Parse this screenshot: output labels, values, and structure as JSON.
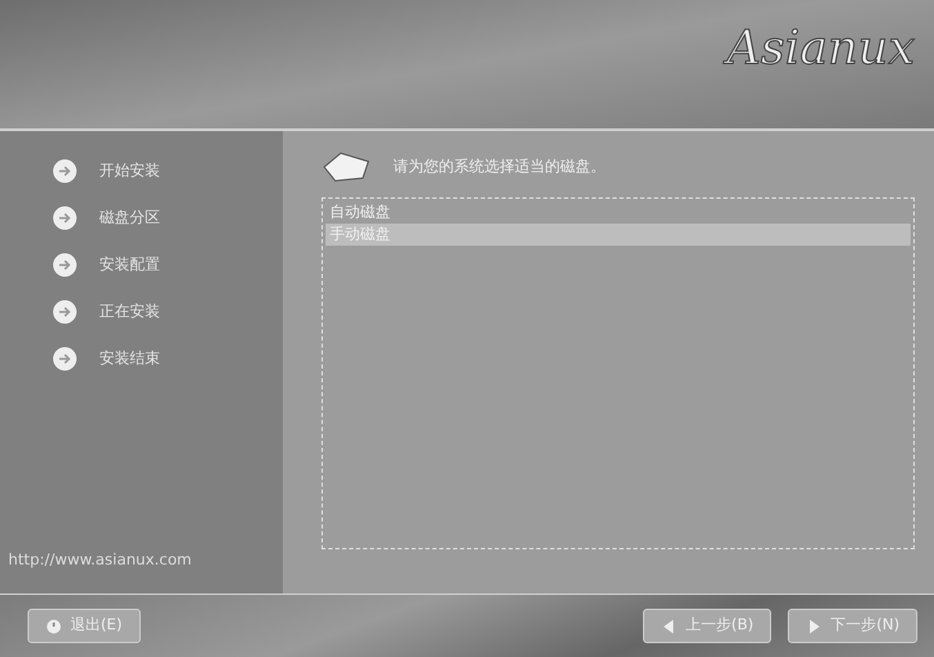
{
  "header": {
    "logo": "Asianux"
  },
  "steps": [
    {
      "label": "开始安装"
    },
    {
      "label": "磁盘分区"
    },
    {
      "label": "安装配置"
    },
    {
      "label": "正在安装"
    },
    {
      "label": "安装结束"
    }
  ],
  "website": "http://www.asianux.com",
  "prompt": "请为您的系统选择适当的磁盘。",
  "options": [
    {
      "label": "自动磁盘",
      "selected": false
    },
    {
      "label": "手动磁盘",
      "selected": true
    }
  ],
  "buttons": [
    {
      "kind": "exit",
      "label": "退出(E)"
    },
    {
      "kind": "back",
      "label": "上一步(B)"
    },
    {
      "kind": "next",
      "label": "下一步(N)"
    }
  ]
}
